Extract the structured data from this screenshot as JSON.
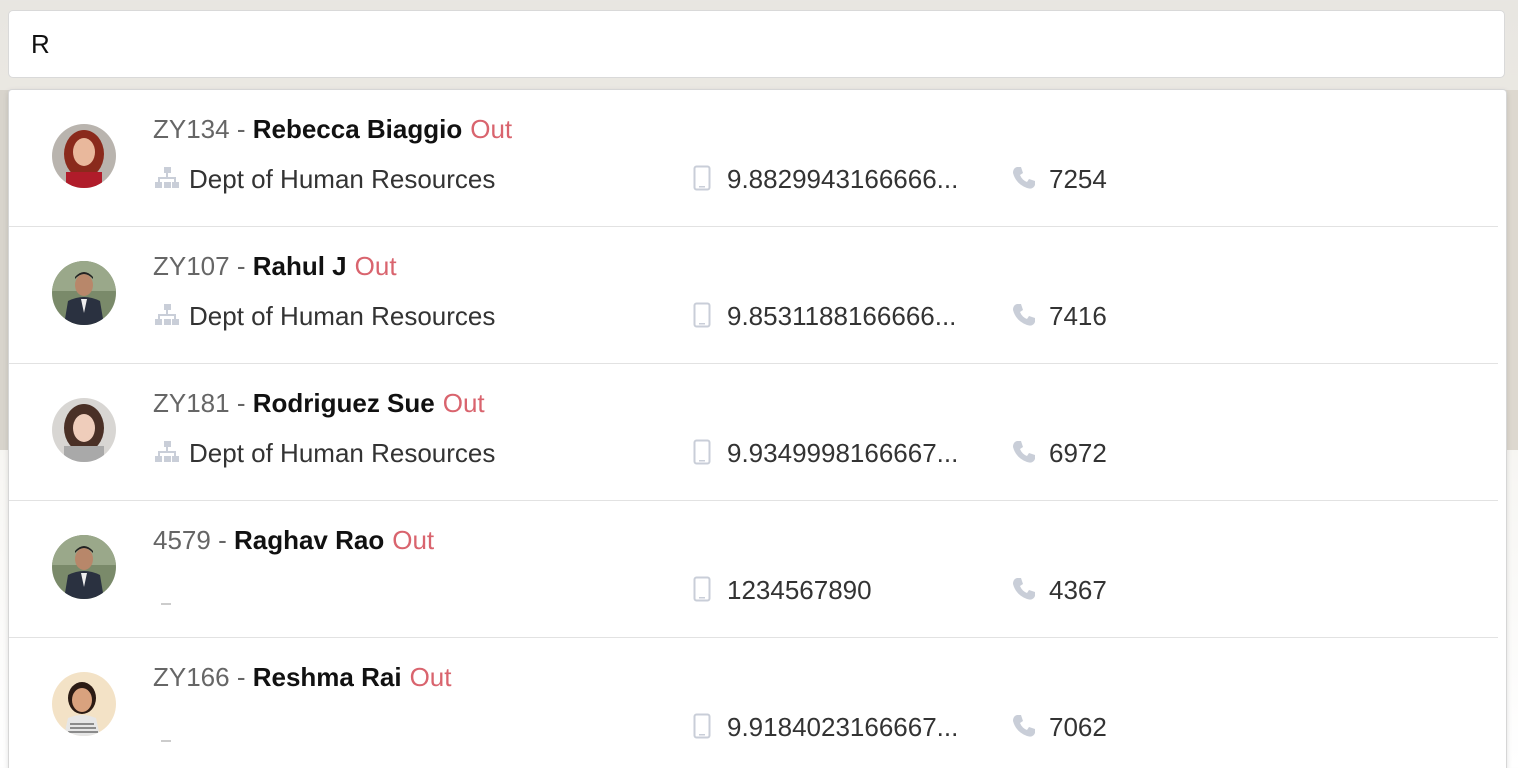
{
  "search": {
    "value": "R",
    "placeholder": ""
  },
  "results": [
    {
      "id": "ZY134",
      "separator": " - ",
      "name": "Rebecca Biaggio",
      "status": "Out",
      "department": "Dept of Human Resources",
      "mobile": "9.8829943166666...",
      "extension": "7254",
      "avatar": "woman-red-hair"
    },
    {
      "id": "ZY107",
      "separator": " - ",
      "name": "Rahul J",
      "status": "Out",
      "department": "Dept of Human Resources",
      "mobile": "9.8531188166666...",
      "extension": "7416",
      "avatar": "man-suit"
    },
    {
      "id": "ZY181",
      "separator": " - ",
      "name": "Rodriguez Sue",
      "status": "Out",
      "department": "Dept of Human Resources",
      "mobile": "9.9349998166667...",
      "extension": "6972",
      "avatar": "woman-dark-hair"
    },
    {
      "id": "4579",
      "separator": " - ",
      "name": "Raghav Rao",
      "status": "Out",
      "department": "",
      "mobile": "1234567890",
      "extension": "4367",
      "avatar": "man-suit"
    },
    {
      "id": "ZY166",
      "separator": " - ",
      "name": "Reshma Rai",
      "status": "Out",
      "department": "",
      "mobile": "9.9184023166667...",
      "extension": "7062",
      "avatar": "woman-smiling"
    }
  ],
  "colors": {
    "status_out": "#d9646e",
    "icon_gray": "#c9ced8"
  }
}
